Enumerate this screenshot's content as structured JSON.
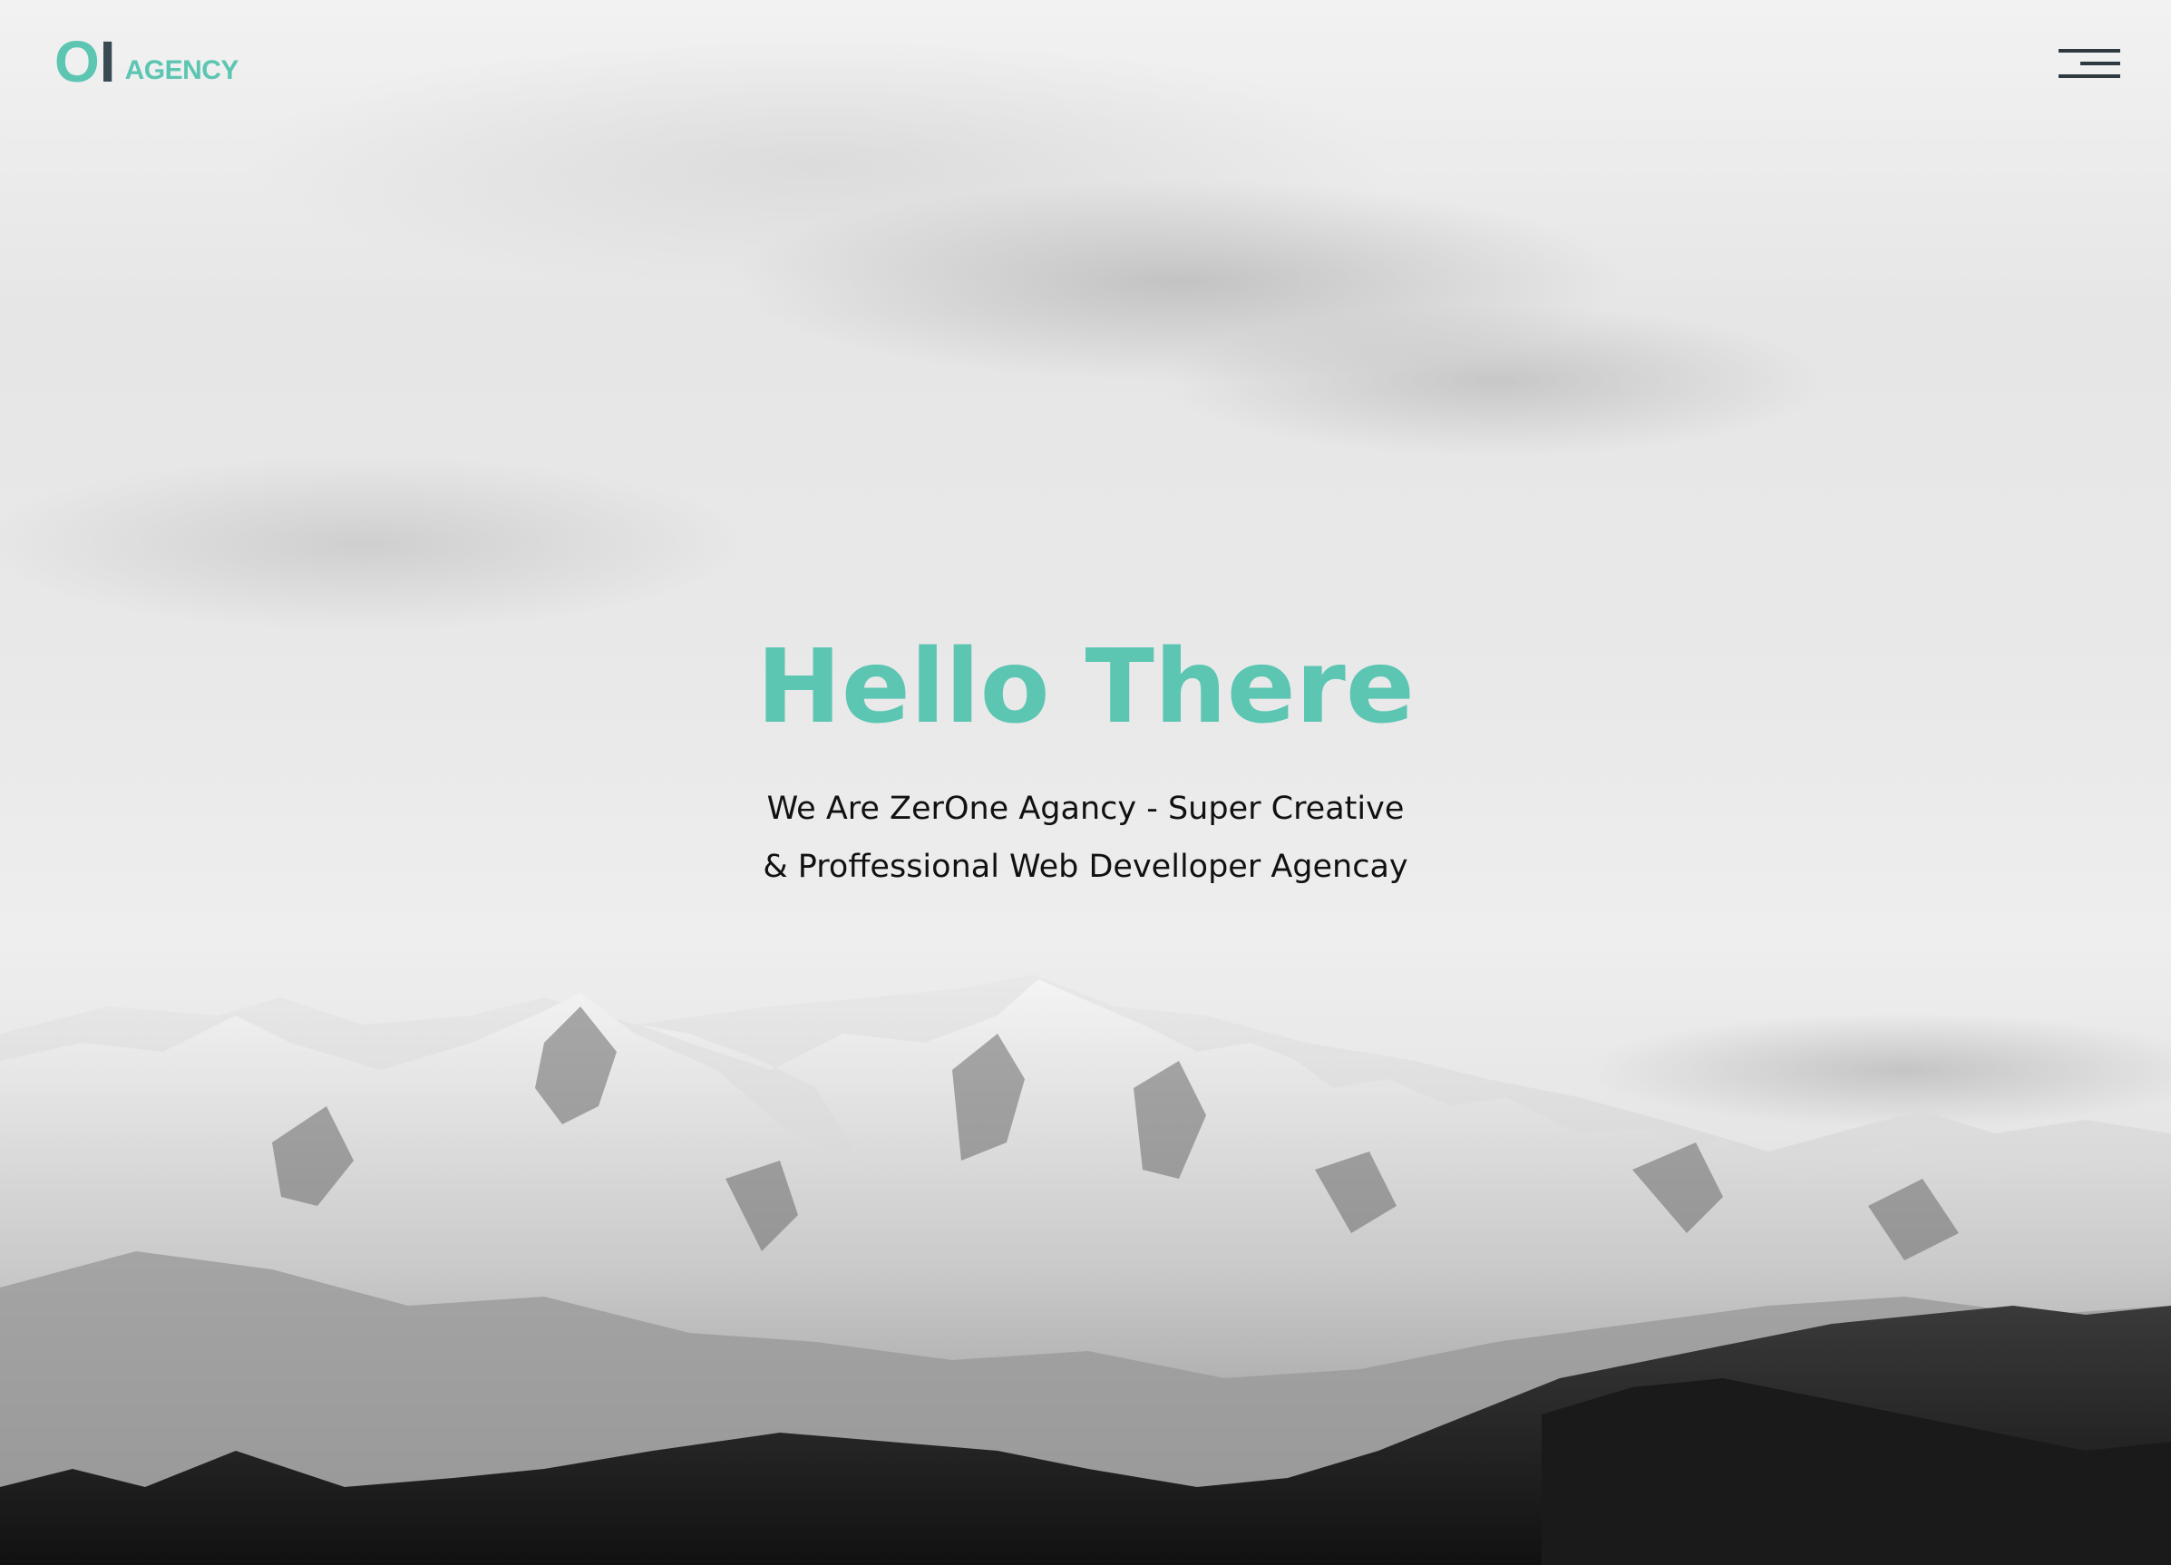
{
  "header": {
    "logo": {
      "mark_o": "O",
      "mark_i": "I",
      "text": "AGENCY"
    },
    "menu": {
      "icon": "hamburger-menu-icon"
    }
  },
  "hero": {
    "title": "Hello There",
    "subtitle_line1": "We Are ZerOne Agancy - Super Creative",
    "subtitle_line2": "& Proffessional Web Develloper Agencay",
    "background": "snow-capped-mountains-grayscale-photo"
  },
  "colors": {
    "accent": "#5cc6b3",
    "logo_dark": "#3a4a52",
    "text": "#111111",
    "menu_icon": "#2e3a40"
  }
}
